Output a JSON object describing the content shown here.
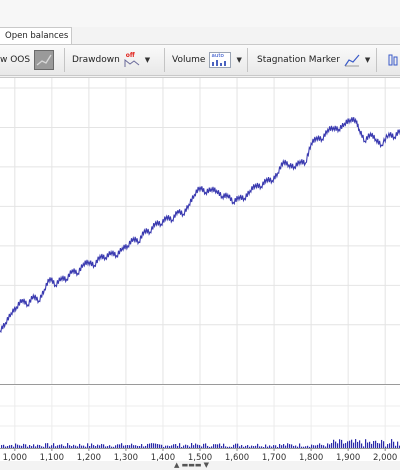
{
  "tabs": {
    "active": "Open balances"
  },
  "toolbar": {
    "oos_label": "w OOS",
    "drawdown_label": "Drawdown",
    "drawdown_state": "off",
    "volume_label": "Volume",
    "volume_state": "auto",
    "stagnation_label": "Stagnation Marker"
  },
  "chart_data": {
    "type": "line",
    "x_tick_labels": [
      "1,000",
      "1,100",
      "1,200",
      "1,300",
      "1,400",
      "1,500",
      "1,600",
      "1,700",
      "1,800",
      "1,900",
      "2,000"
    ],
    "series": [
      {
        "color": "#3a3ab0",
        "points": [
          [
            960,
            -0.3
          ],
          [
            975,
            0.1
          ],
          [
            990,
            0.6
          ],
          [
            1005,
            0.9
          ],
          [
            1020,
            1.3
          ],
          [
            1035,
            1.0
          ],
          [
            1050,
            1.5
          ],
          [
            1065,
            1.2
          ],
          [
            1080,
            1.8
          ],
          [
            1095,
            2.4
          ],
          [
            1110,
            2.0
          ],
          [
            1125,
            2.4
          ],
          [
            1140,
            2.3
          ],
          [
            1155,
            2.8
          ],
          [
            1170,
            2.6
          ],
          [
            1185,
            3.1
          ],
          [
            1200,
            3.2
          ],
          [
            1215,
            3.0
          ],
          [
            1230,
            3.5
          ],
          [
            1245,
            3.4
          ],
          [
            1260,
            3.7
          ],
          [
            1275,
            3.5
          ],
          [
            1290,
            3.9
          ],
          [
            1305,
            4.0
          ],
          [
            1320,
            4.4
          ],
          [
            1335,
            4.2
          ],
          [
            1350,
            4.8
          ],
          [
            1365,
            4.7
          ],
          [
            1380,
            5.2
          ],
          [
            1395,
            5.1
          ],
          [
            1410,
            5.5
          ],
          [
            1425,
            5.3
          ],
          [
            1440,
            5.8
          ],
          [
            1455,
            5.6
          ],
          [
            1470,
            6.1
          ],
          [
            1485,
            6.6
          ],
          [
            1500,
            7.0
          ],
          [
            1515,
            6.7
          ],
          [
            1530,
            6.9
          ],
          [
            1545,
            6.8
          ],
          [
            1560,
            6.5
          ],
          [
            1575,
            6.6
          ],
          [
            1590,
            6.2
          ],
          [
            1605,
            6.5
          ],
          [
            1620,
            6.4
          ],
          [
            1635,
            6.8
          ],
          [
            1650,
            7.1
          ],
          [
            1665,
            7.0
          ],
          [
            1680,
            7.4
          ],
          [
            1695,
            7.3
          ],
          [
            1710,
            7.7
          ],
          [
            1725,
            8.3
          ],
          [
            1740,
            8.1
          ],
          [
            1755,
            8.0
          ],
          [
            1770,
            8.3
          ],
          [
            1785,
            8.2
          ],
          [
            1800,
            9.2
          ],
          [
            1815,
            9.5
          ],
          [
            1830,
            9.4
          ],
          [
            1845,
            9.9
          ],
          [
            1860,
            10.0
          ],
          [
            1875,
            9.9
          ],
          [
            1890,
            10.2
          ],
          [
            1905,
            10.4
          ],
          [
            1920,
            10.4
          ],
          [
            1930,
            9.9
          ],
          [
            1945,
            9.3
          ],
          [
            1960,
            9.7
          ],
          [
            1975,
            9.4
          ],
          [
            1990,
            9.1
          ],
          [
            2010,
            9.7
          ],
          [
            2025,
            9.5
          ],
          [
            2040,
            9.9
          ]
        ]
      }
    ],
    "grid": true
  }
}
